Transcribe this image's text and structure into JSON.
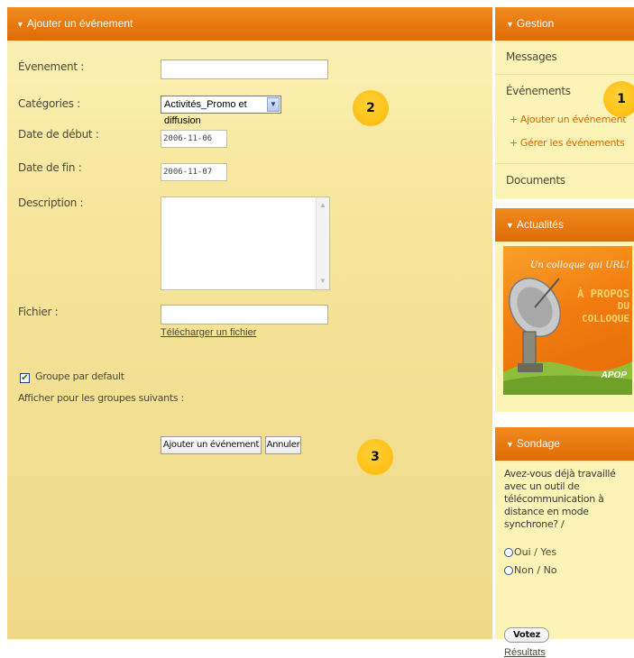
{
  "form": {
    "header": "Ajouter un événement",
    "event_label": "Évenement :",
    "event_value": "",
    "categories_label": "Catégories :",
    "categories_selected": "Activités_Promo et diffusion",
    "start_label": "Date de début :",
    "start_value": "2006-11-06",
    "end_label": "Date de fin :",
    "end_value": "2006-11-07",
    "description_label": "Description :",
    "file_label": "Fichier :",
    "file_value": "",
    "upload_link": "Télécharger un fichier",
    "default_group_label": "Groupe par default",
    "default_group_checked": true,
    "groups_label": "Afficher pour les groupes suivants :",
    "submit_label": "Ajouter un événement",
    "cancel_label": "Annuler"
  },
  "badges": [
    "1",
    "2",
    "3"
  ],
  "sidebar": {
    "gestion_header": "Gestion",
    "messages": "Messages",
    "evenements": "Événements",
    "sub_add": "Ajouter un événement",
    "sub_manage": "Gérer les événements",
    "documents": "Documents",
    "actualites_header": "Actualités",
    "news_image_title": "Un colloque qui URL!",
    "news_image_sub1": "À PROPOS",
    "news_image_sub2": "DU COLLOQUE",
    "news_image_logo": "APOP",
    "sondage_header": "Sondage",
    "poll_question": "Avez-vous déjà travaillé avec un outil de télécommunication à distance en mode synchrone? /",
    "poll_option_yes": "Oui / Yes",
    "poll_option_no": "Non / No",
    "vote_label": "Votez",
    "results_link": "Résultats"
  },
  "colors": {
    "header_orange": "#e8780f",
    "panel_yellow": "#fcf2b8",
    "link_orange": "#d66a00"
  }
}
